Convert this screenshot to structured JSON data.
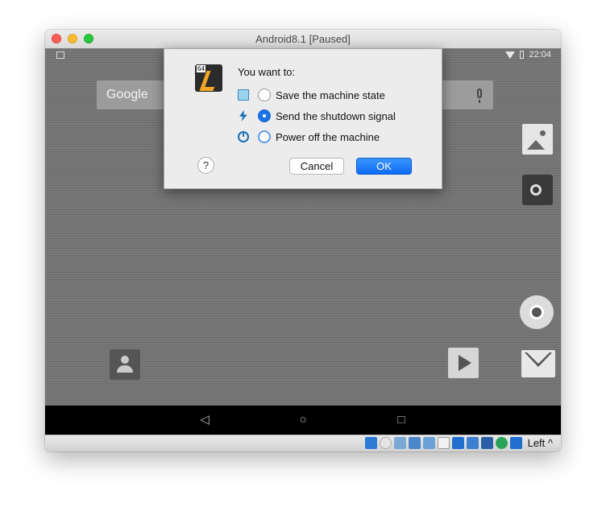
{
  "window": {
    "title": "Android8.1 [Paused]"
  },
  "android": {
    "status_time": "22:04",
    "search_logo": "Google",
    "apps": [
      "gallery-icon",
      "music-icon",
      "chrome-icon",
      "gmail-icon",
      "contacts-icon",
      "play-store-icon"
    ],
    "nav": {
      "back": "◁",
      "home": "○",
      "recents": "□"
    }
  },
  "dialog": {
    "prompt": "You want to:",
    "options": [
      {
        "label": "Save the machine state",
        "icon": "save-state-icon",
        "selected": false
      },
      {
        "label": "Send the shutdown signal",
        "icon": "shutdown-signal-icon",
        "selected": true
      },
      {
        "label": "Power off the machine",
        "icon": "power-off-icon",
        "selected": false
      }
    ],
    "help_label": "?",
    "cancel_label": "Cancel",
    "ok_label": "OK"
  },
  "statusbar": {
    "icons": [
      "hard-disk-icon",
      "optical-drive-icon",
      "audio-icon",
      "network-icon",
      "usb-icon",
      "shared-folders-icon",
      "display-icon",
      "video-capture-icon",
      "cpu-icon",
      "mouse-integration-icon",
      "guest-additions-icon",
      "arrow-down-icon"
    ],
    "host_key": "Left ^"
  },
  "colors": {
    "accent": "#1a73e8",
    "ok_button": "#0a6cf5",
    "screen_bg": "#757575"
  }
}
